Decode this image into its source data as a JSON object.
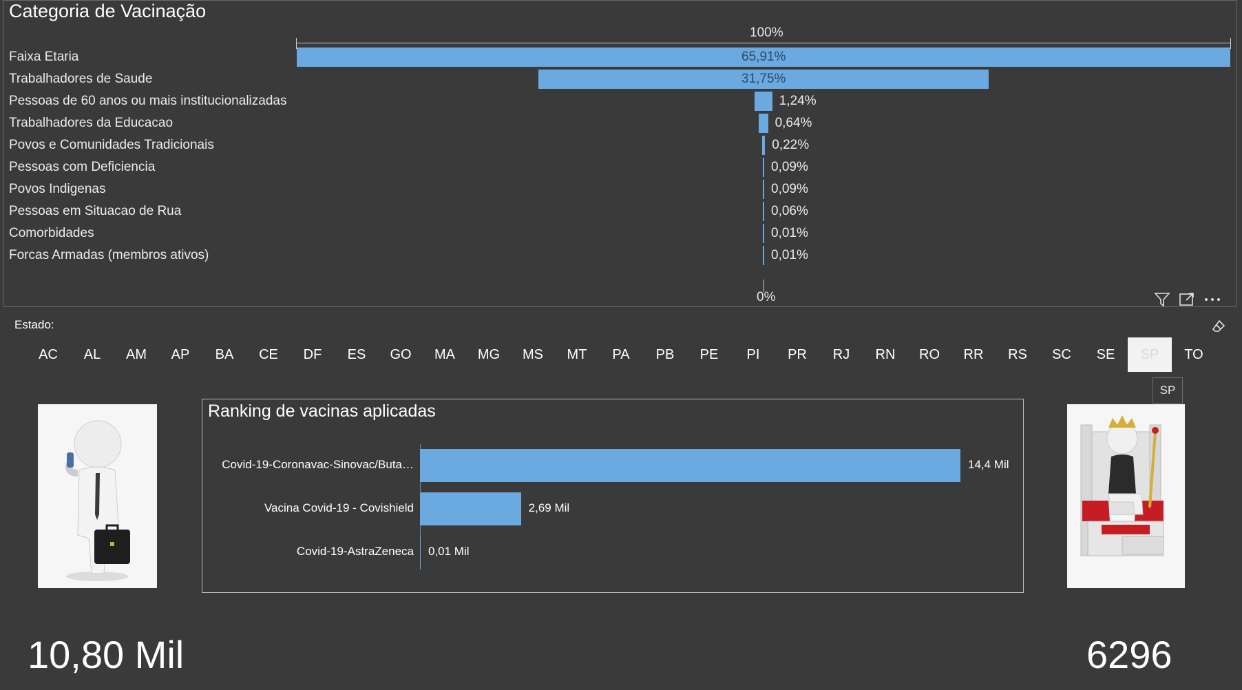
{
  "funnel": {
    "title": "Categoria de Vacinação",
    "top_label": "100%",
    "bottom_label": "0%",
    "bar_color": "#6aaae1",
    "categories": [
      {
        "label": "Faixa Etaria",
        "value": "65,91%",
        "pct": 65.91
      },
      {
        "label": "Trabalhadores de Saude",
        "value": "31,75%",
        "pct": 31.75
      },
      {
        "label": "Pessoas de 60 anos ou mais institucionalizadas",
        "value": "1,24%",
        "pct": 1.24
      },
      {
        "label": "Trabalhadores da Educacao",
        "value": "0,64%",
        "pct": 0.64
      },
      {
        "label": "Povos e Comunidades Tradicionais",
        "value": "0,22%",
        "pct": 0.22
      },
      {
        "label": "Pessoas com Deficiencia",
        "value": "0,09%",
        "pct": 0.09
      },
      {
        "label": "Povos Indigenas",
        "value": "0,09%",
        "pct": 0.09
      },
      {
        "label": "Pessoas em Situacao de Rua",
        "value": "0,06%",
        "pct": 0.06
      },
      {
        "label": "Comorbidades",
        "value": "0,01%",
        "pct": 0.01
      },
      {
        "label": "Forcas Armadas (membros ativos)",
        "value": "0,01%",
        "pct": 0.01
      }
    ]
  },
  "visual_header": {
    "icons": [
      "filter-icon",
      "focus-mode-icon",
      "more-options-icon"
    ]
  },
  "slicer": {
    "label": "Estado:",
    "states": [
      "AC",
      "AL",
      "AM",
      "AP",
      "BA",
      "CE",
      "DF",
      "ES",
      "GO",
      "MA",
      "MG",
      "MS",
      "MT",
      "PA",
      "PB",
      "PE",
      "PI",
      "PR",
      "RJ",
      "RN",
      "RO",
      "RR",
      "RS",
      "SC",
      "SE",
      "SP",
      "TO"
    ],
    "selected": "SP",
    "tooltip": "SP"
  },
  "ranking": {
    "title": "Ranking de vacinas aplicadas",
    "items": [
      {
        "label": "Covid-19-Coronavac-Sinovac/Buta…",
        "value": "14,4 Mil",
        "amount": 14.4
      },
      {
        "label": "Vacina Covid-19 - Covishield",
        "value": "2,69 Mil",
        "amount": 2.69
      },
      {
        "label": "Covid-19-AstraZeneca",
        "value": "0,01 Mil",
        "amount": 0.01
      }
    ]
  },
  "kpis": {
    "left": "10,80 Mil",
    "right": "6296"
  }
}
